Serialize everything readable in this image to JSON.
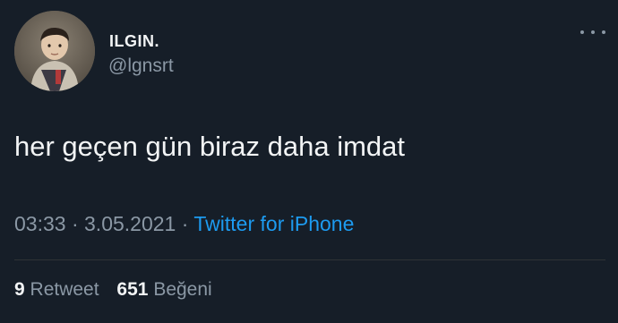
{
  "author": {
    "display_name": "ILGIN.",
    "handle": "@lgnsrt",
    "avatar_icon": "profile-photo"
  },
  "tweet": {
    "text": "her geçen gün biraz daha imdat",
    "time": "03:33",
    "date": "3.05.2021",
    "separator": "·",
    "source": "Twitter for iPhone"
  },
  "stats": {
    "retweets_count": "9",
    "retweets_label": "Retweet",
    "likes_count": "651",
    "likes_label": "Beğeni"
  },
  "colors": {
    "background": "#161e28",
    "link": "#1d9bf0",
    "secondary_text": "#8b98a5"
  }
}
